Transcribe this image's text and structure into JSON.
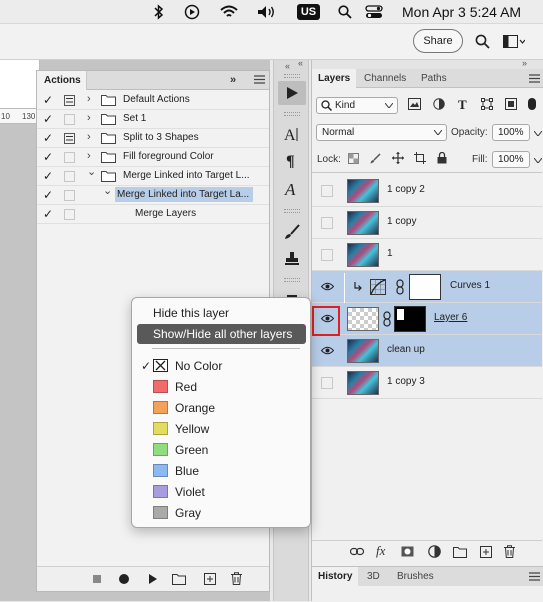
{
  "menubar": {
    "input_source": "US",
    "datetime": "Mon Apr 3  5:24 AM"
  },
  "optionsbar": {
    "share_label": "Share"
  },
  "ruler": {
    "tick_labels": [
      "10",
      "130"
    ]
  },
  "actions_panel": {
    "tab_label": "Actions",
    "rows": [
      {
        "checked": true,
        "dialog": true,
        "expanded": false,
        "folder": true,
        "indent": 0,
        "label": "Default Actions"
      },
      {
        "checked": true,
        "dialog": false,
        "expanded": false,
        "folder": true,
        "indent": 0,
        "label": "Set 1"
      },
      {
        "checked": true,
        "dialog": true,
        "expanded": false,
        "folder": true,
        "indent": 0,
        "label": "Split to 3 Shapes"
      },
      {
        "checked": true,
        "dialog": false,
        "expanded": false,
        "folder": true,
        "indent": 0,
        "label": "Fill foreground Color"
      },
      {
        "checked": true,
        "dialog": false,
        "expanded": true,
        "folder": true,
        "indent": 0,
        "label": "Merge Linked into Target L..."
      },
      {
        "checked": true,
        "dialog": false,
        "expanded": true,
        "folder": false,
        "indent": 1,
        "label": "Merge Linked into Target La...",
        "selected": true
      },
      {
        "checked": true,
        "dialog": false,
        "expanded": false,
        "folder": false,
        "indent": 2,
        "label": "Merge Layers"
      }
    ]
  },
  "layers_panel": {
    "tabs": [
      "Layers",
      "Channels",
      "Paths"
    ],
    "filter_label": "Kind",
    "blend_mode": "Normal",
    "opacity_label": "Opacity:",
    "opacity_value": "100%",
    "lock_label": "Lock:",
    "fill_label": "Fill:",
    "fill_value": "100%",
    "layers": [
      {
        "name": "1 copy 2",
        "visible": false,
        "type": "image",
        "highlighted": false
      },
      {
        "name": "1 copy",
        "visible": false,
        "type": "image",
        "highlighted": false
      },
      {
        "name": "1",
        "visible": false,
        "type": "image",
        "highlighted": false
      },
      {
        "name": "Curves 1",
        "visible": true,
        "type": "adjustment",
        "highlighted": true
      },
      {
        "name": "Layer 6",
        "visible": true,
        "type": "masked",
        "highlighted": true
      },
      {
        "name": "clean up",
        "visible": true,
        "type": "image",
        "highlighted": true
      },
      {
        "name": "1 copy 3",
        "visible": false,
        "type": "image",
        "highlighted": false
      }
    ]
  },
  "history_panel": {
    "tabs": [
      "History",
      "3D",
      "Brushes"
    ]
  },
  "context_menu": {
    "items": [
      "Hide this layer",
      "Show/Hide all other layers"
    ],
    "active_item": "Show/Hide all other layers",
    "colors": [
      {
        "label": "No Color",
        "hex": "none",
        "checked": true
      },
      {
        "label": "Red",
        "hex": "#f26b6b",
        "checked": false
      },
      {
        "label": "Orange",
        "hex": "#f4a25a",
        "checked": false
      },
      {
        "label": "Yellow",
        "hex": "#e2dd5e",
        "checked": false
      },
      {
        "label": "Green",
        "hex": "#8fdd7f",
        "checked": false
      },
      {
        "label": "Blue",
        "hex": "#8db9f2",
        "checked": false
      },
      {
        "label": "Violet",
        "hex": "#a99be0",
        "checked": false
      },
      {
        "label": "Gray",
        "hex": "#aaaaaa",
        "checked": false
      }
    ]
  },
  "colors": {
    "highlight_row": "#b8cde8",
    "selected_action": "#b8cde8",
    "eye_outline": "#e02020",
    "menu_active": "#595959"
  }
}
